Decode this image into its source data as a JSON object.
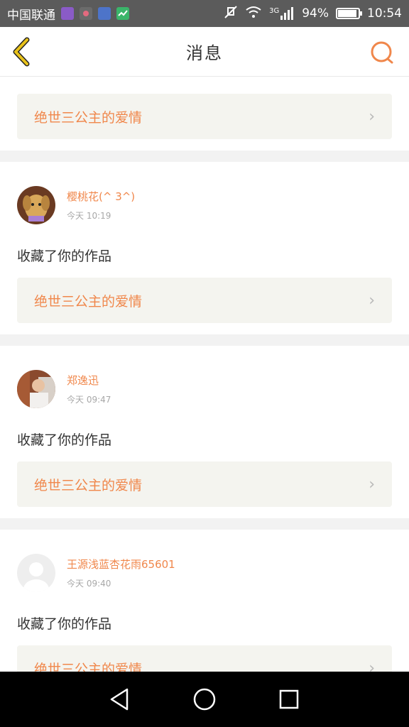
{
  "status_bar": {
    "carrier": "中国联通",
    "signal": "3G",
    "battery": "94%",
    "time": "10:54",
    "icons": [
      "gallery-app-icon",
      "flower-app-icon",
      "cloud-app-icon",
      "stocks-app-icon",
      "mute-icon",
      "wifi-icon",
      "signal-icon",
      "battery-icon"
    ],
    "battery_level": 0.94
  },
  "header": {
    "title": "消息",
    "back_icon": "chevron-left-icon",
    "search_icon": "search-icon",
    "accent_color": "#f0874b"
  },
  "messages": [
    {
      "partial": true,
      "work_title": "绝世三公主的爱情"
    },
    {
      "user": "樱桃花(^ 3^)",
      "time": "今天 10:19",
      "action": "收藏了你的作品",
      "work_title": "绝世三公主的爱情"
    },
    {
      "user": "郑逸迅",
      "time": "今天 09:47",
      "action": "收藏了你的作品",
      "work_title": "绝世三公主的爱情"
    },
    {
      "user": "王源浅蓝杏花雨65601",
      "time": "今天 09:40",
      "action": "收藏了你的作品",
      "work_title": "绝世三公主的爱情"
    }
  ],
  "nav_bar": {
    "buttons": [
      "back-triangle-icon",
      "home-circle-icon",
      "recents-square-icon"
    ]
  }
}
